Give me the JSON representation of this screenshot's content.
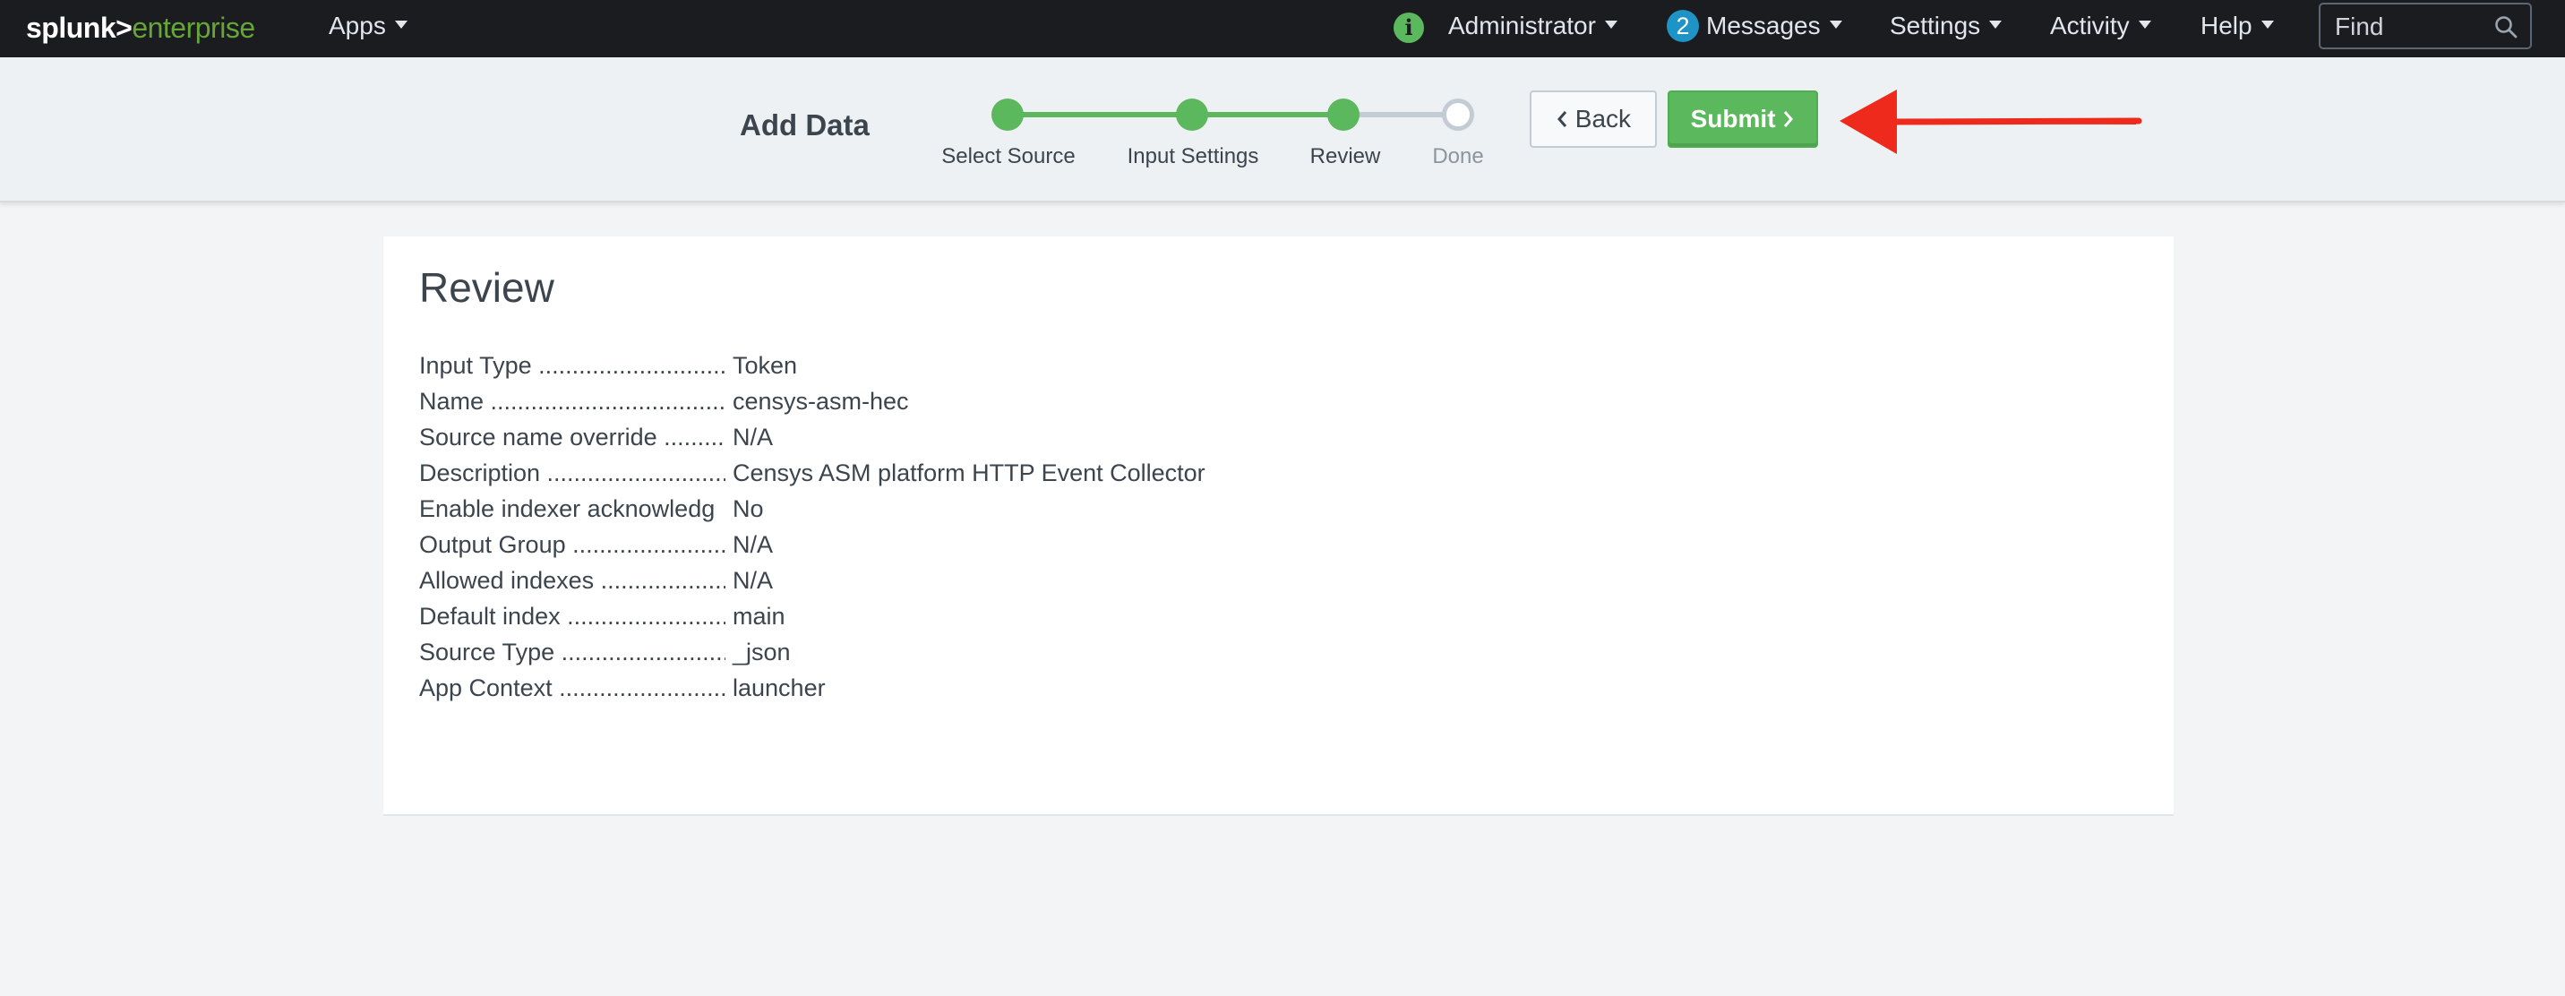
{
  "topbar": {
    "logo_primary": "splunk>",
    "logo_secondary": "enterprise",
    "apps_label": "Apps",
    "info_icon_glyph": "i",
    "user_label": "Administrator",
    "messages_count": "2",
    "messages_label": "Messages",
    "settings_label": "Settings",
    "activity_label": "Activity",
    "help_label": "Help",
    "find_placeholder": "Find"
  },
  "wizard": {
    "title": "Add Data",
    "steps": [
      {
        "label": "Select Source",
        "state": "complete"
      },
      {
        "label": "Input Settings",
        "state": "complete"
      },
      {
        "label": "Review",
        "state": "current"
      },
      {
        "label": "Done",
        "state": "pending"
      }
    ],
    "back_label": "Back",
    "submit_label": "Submit"
  },
  "review": {
    "title": "Review",
    "rows": [
      {
        "key": "Input Type ................................",
        "value": "Token"
      },
      {
        "key": "Name ........................................",
        "value": "censys-asm-hec"
      },
      {
        "key": "Source name override .........",
        "value": "N/A"
      },
      {
        "key": "Description ..............................",
        "value": "Censys ASM platform HTTP Event Collector"
      },
      {
        "key": "Enable indexer acknowledg",
        "value": "No"
      },
      {
        "key": "Output Group .........................",
        "value": "N/A"
      },
      {
        "key": "Allowed indexes ....................",
        "value": "N/A"
      },
      {
        "key": "Default index ..........................",
        "value": "main"
      },
      {
        "key": "Source Type ............................",
        "value": "_json"
      },
      {
        "key": "App Context ............................",
        "value": "launcher"
      }
    ]
  },
  "colors": {
    "topbar_bg": "#1a1c20",
    "accent_green": "#5cb85c",
    "badge_blue": "#1e93c6",
    "annotation_red": "#ee2a1d"
  }
}
